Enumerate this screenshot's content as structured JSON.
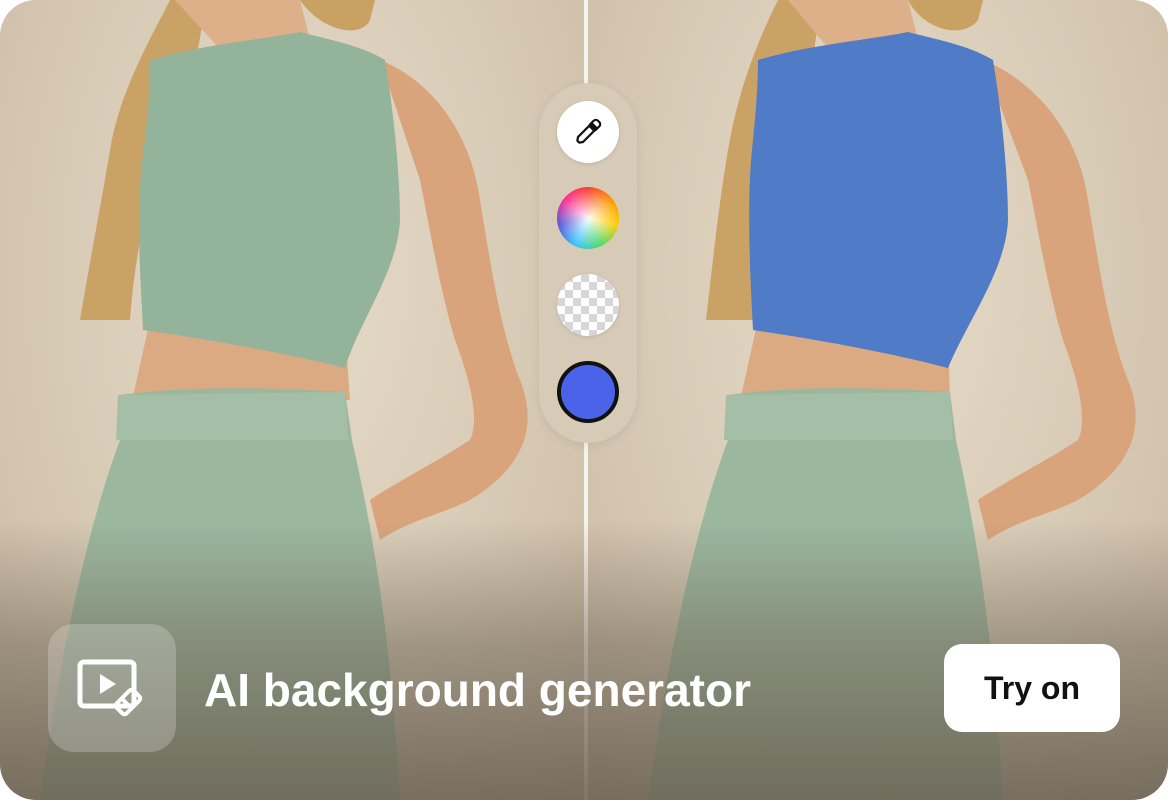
{
  "comparison": {
    "before_top_color": "#93b49a",
    "after_top_color": "#4f7bc7",
    "pants_color": "#9bb89f"
  },
  "toolbar": {
    "tools": [
      {
        "name": "eyedropper-icon",
        "kind": "eyedropper"
      },
      {
        "name": "color-wheel",
        "kind": "spectrum"
      },
      {
        "name": "transparent-background",
        "kind": "transparent"
      },
      {
        "name": "solid-color",
        "kind": "color",
        "color": "#4a63e8"
      }
    ]
  },
  "feature": {
    "icon": "video-eraser-icon",
    "title": "AI background generator",
    "cta_label": "Try on"
  }
}
